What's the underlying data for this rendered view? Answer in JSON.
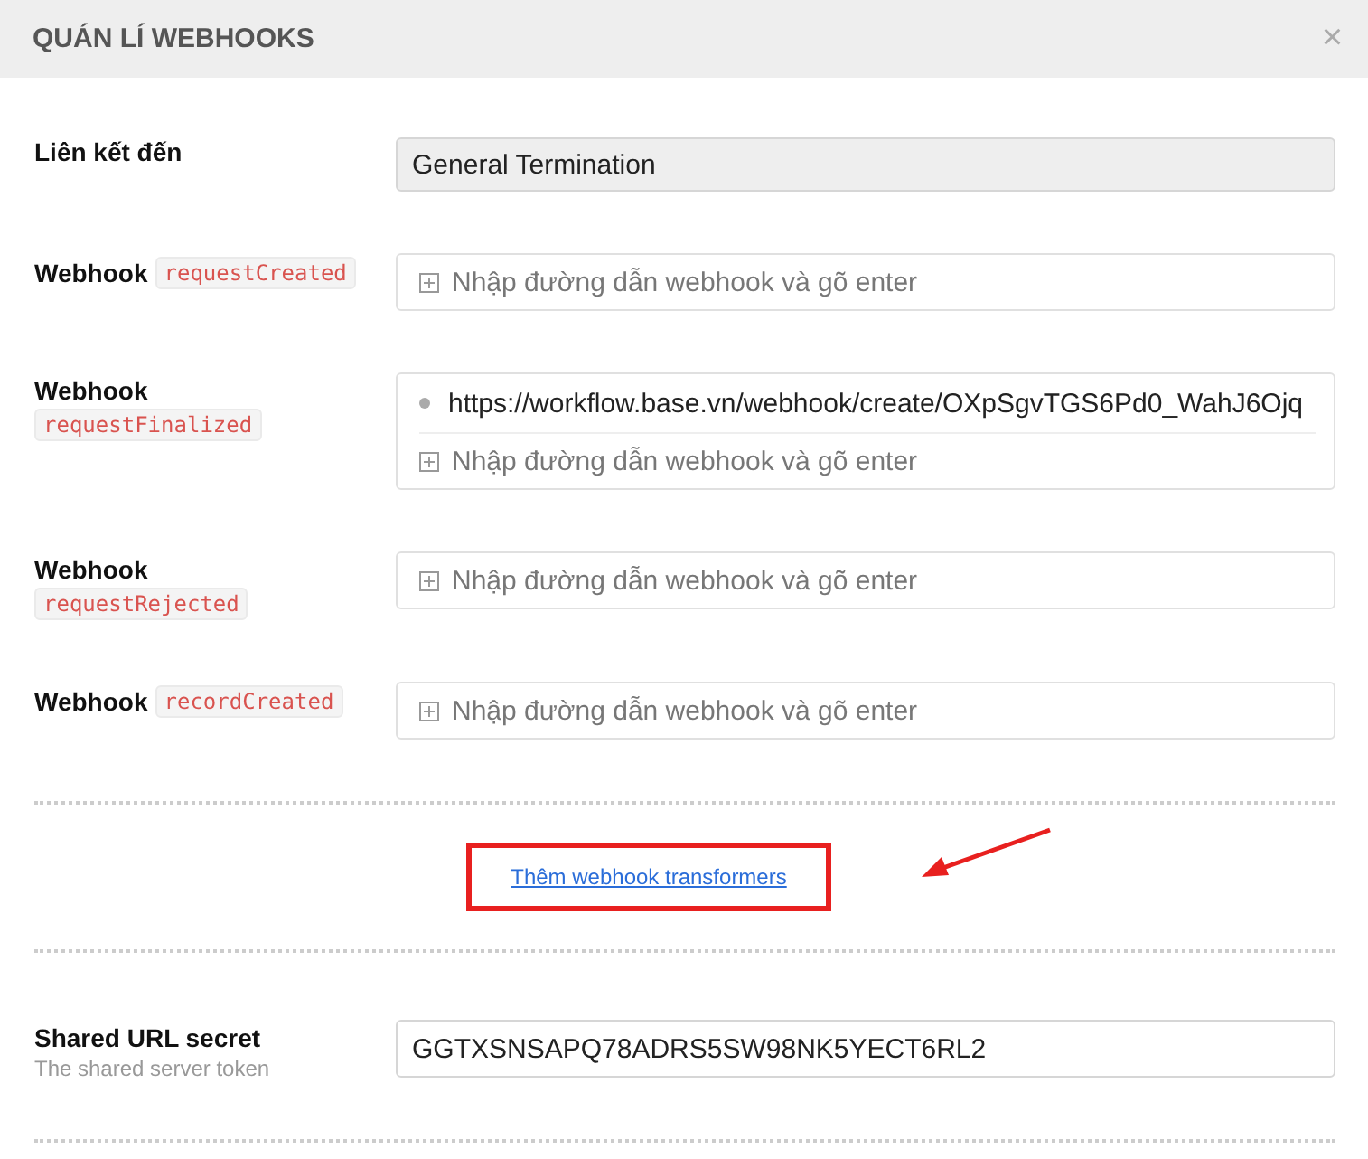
{
  "dialog": {
    "title": "QUÁN LÍ WEBHOOKS",
    "close": "×"
  },
  "link_to": {
    "label": "Liên kết đến",
    "value": "General Termination"
  },
  "webhooks": [
    {
      "label": "Webhook",
      "event": "requestCreated",
      "kind": "inline",
      "placeholder": "Nhập đường dẫn webhook và gõ enter"
    },
    {
      "label": "Webhook",
      "event": "requestFinalized",
      "kind": "stacked",
      "urls": [
        "https://workflow.base.vn/webhook/create/OXpSgvTGS6Pd0_WahJ6Ojq"
      ],
      "placeholder": "Nhập đường dẫn webhook và gõ enter"
    },
    {
      "label": "Webhook",
      "event": "requestRejected",
      "kind": "stacked",
      "placeholder": "Nhập đường dẫn webhook và gõ enter"
    },
    {
      "label": "Webhook",
      "event": "recordCreated",
      "kind": "inline",
      "placeholder": "Nhập đường dẫn webhook và gõ enter"
    }
  ],
  "transformers_link": "Thêm webhook transformers",
  "secret": {
    "label": "Shared URL secret",
    "hint": "The shared server token",
    "value": "GGTXSNSAPQ78ADRS5SW98NK5YECT6RL2"
  }
}
